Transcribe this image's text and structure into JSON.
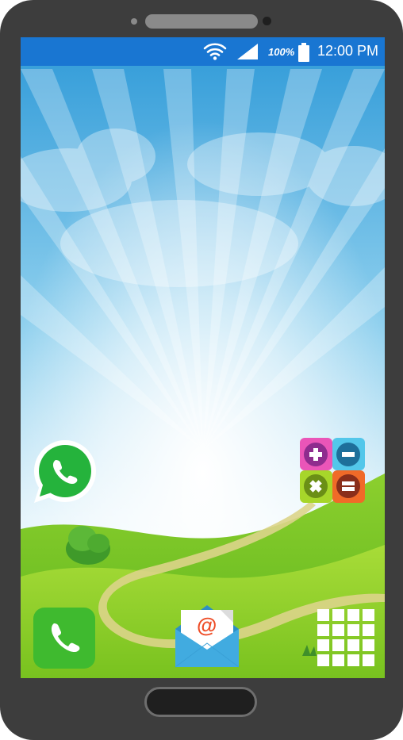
{
  "status_bar": {
    "battery_percent": "100%",
    "time": "12:00 PM",
    "icons": [
      "wifi-icon",
      "signal-icon",
      "battery-icon"
    ]
  },
  "home_screen": {
    "apps": [
      {
        "id": "whatsapp",
        "icon": "whatsapp-icon"
      },
      {
        "id": "calculator",
        "icon": "calculator-icon"
      },
      {
        "id": "phone",
        "icon": "phone-icon"
      },
      {
        "id": "email",
        "icon": "email-icon",
        "glyph": "@"
      },
      {
        "id": "app-drawer",
        "icon": "app-grid-icon"
      }
    ]
  },
  "colors": {
    "status_bar": "#1976d2",
    "phone_body": "#3d3d3d",
    "whatsapp": "#25b33c",
    "phone_app": "#3fba2f",
    "email": "#41abe0"
  }
}
